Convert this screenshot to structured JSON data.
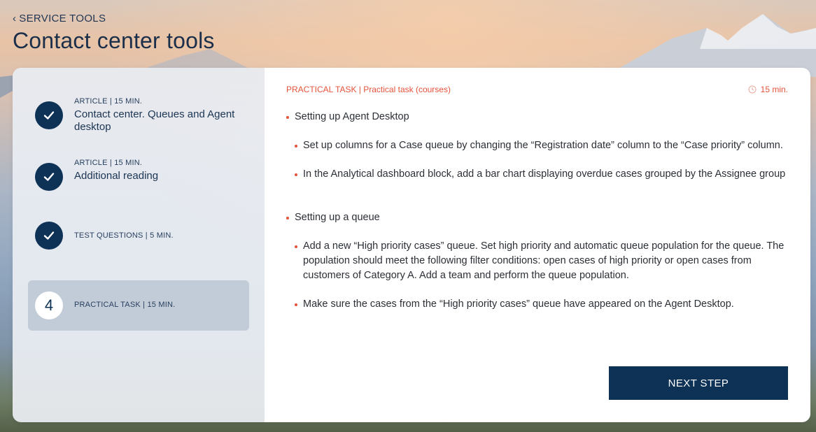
{
  "header": {
    "back_label": "SERVICE TOOLS",
    "title": "Contact center tools"
  },
  "sidebar": {
    "steps": [
      {
        "type": "ARTICLE | 15 MIN.",
        "name": "Contact center. Queues and Agent desktop",
        "status": "completed"
      },
      {
        "type": "ARTICLE | 15 MIN.",
        "name": "Additional reading",
        "status": "completed"
      },
      {
        "type": "TEST QUESTIONS | 5 MIN.",
        "name": "",
        "status": "completed"
      },
      {
        "type": "PRACTICAL TASK | 15 MIN.",
        "name": "",
        "status": "active",
        "number": "4"
      }
    ]
  },
  "main": {
    "meta": "PRACTICAL TASK | Practical task (courses)",
    "duration": "15 min.",
    "sections": [
      {
        "heading": "Setting up Agent Desktop",
        "items": [
          "Set up columns for a Case queue by changing the “Registration date” column to the “Case priority” column.",
          "In the Analytical dashboard block, add a bar chart displaying overdue cases grouped by the Assignee group"
        ]
      },
      {
        "heading": "Setting up a queue",
        "items": [
          "Add a new “High priority cases” queue. Set high priority and automatic queue population for the queue. The population should meet the following filter conditions: open cases of high priority or open cases from customers of Category A. Add a team and  perform the queue population.",
          "Make sure the cases from the “High priority cases” queue have appeared on the Agent Desktop."
        ]
      }
    ],
    "next_label": "NEXT STEP"
  },
  "colors": {
    "navy": "#0e3156",
    "accent": "#e3533a"
  },
  "icons": {
    "back": "chevron-left-icon",
    "completed": "checkmark-icon",
    "timer": "clock-icon"
  }
}
